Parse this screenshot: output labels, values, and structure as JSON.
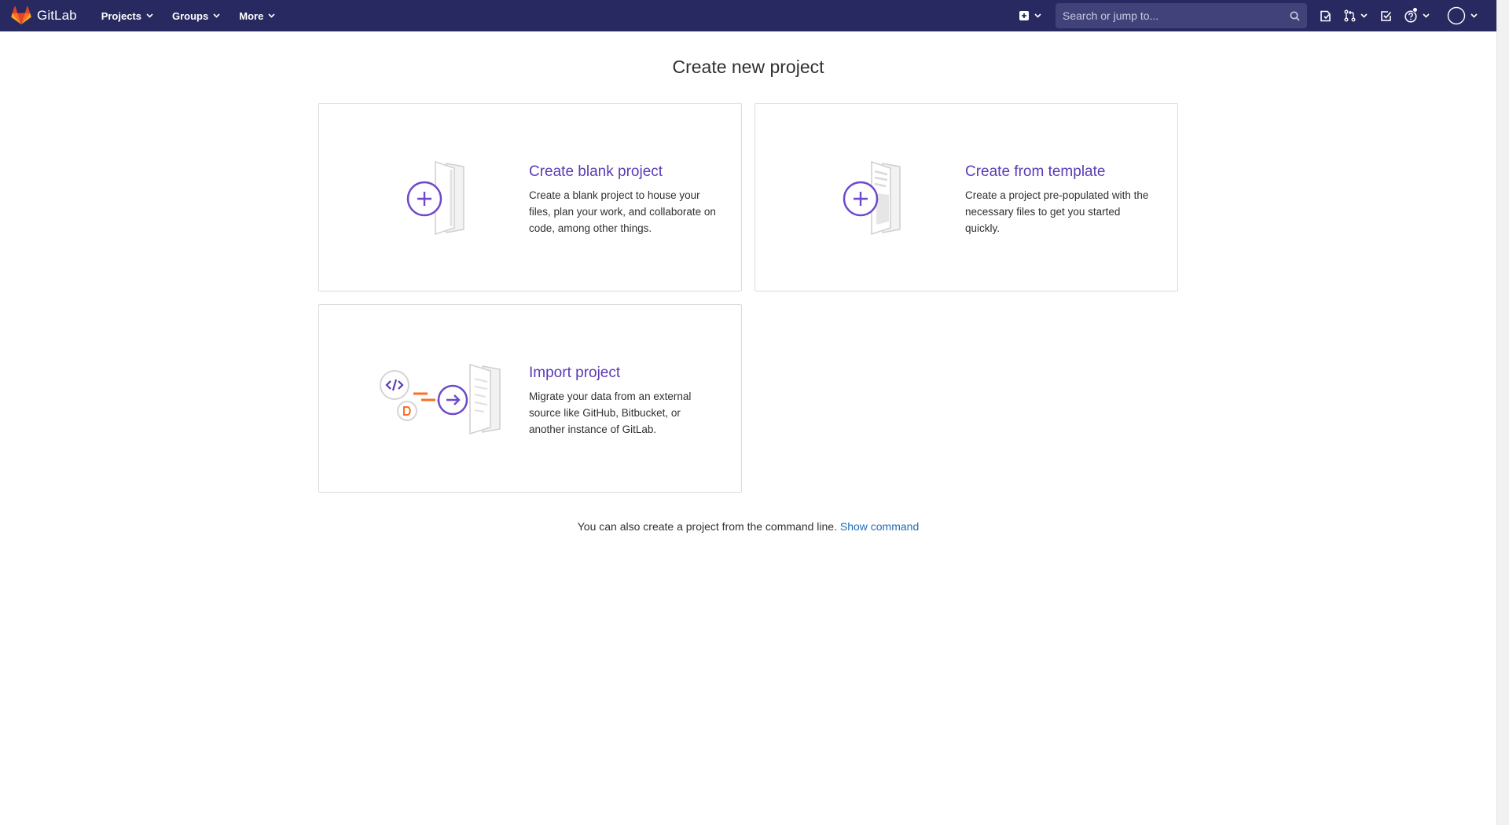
{
  "app": {
    "name": "GitLab"
  },
  "nav": {
    "items": [
      {
        "label": "Projects"
      },
      {
        "label": "Groups"
      },
      {
        "label": "More"
      }
    ],
    "search": {
      "placeholder": "Search or jump to..."
    }
  },
  "page": {
    "title": "Create new project"
  },
  "cards": [
    {
      "title": "Create blank project",
      "description": "Create a blank project to house your files, plan your work, and collaborate on code, among other things.",
      "icon": "blank-project-illustration"
    },
    {
      "title": "Create from template",
      "description": "Create a project pre-populated with the necessary files to get you started quickly.",
      "icon": "template-project-illustration"
    },
    {
      "title": "Import project",
      "description": "Migrate your data from an external source like GitHub, Bitbucket, or another instance of GitLab.",
      "icon": "import-project-illustration"
    }
  ],
  "footer": {
    "text": "You can also create a project from the command line.",
    "link": "Show command"
  },
  "colors": {
    "navbar": "#292961",
    "accent": "#5b3bb5",
    "link": "#1f6bb8",
    "orange": "#fc6d26"
  },
  "icons": [
    "gitlab-logo",
    "chevron-down-icon",
    "plus-square-icon",
    "search-icon",
    "issues-icon",
    "merge-request-icon",
    "todo-icon",
    "help-icon",
    "avatar-icon"
  ]
}
